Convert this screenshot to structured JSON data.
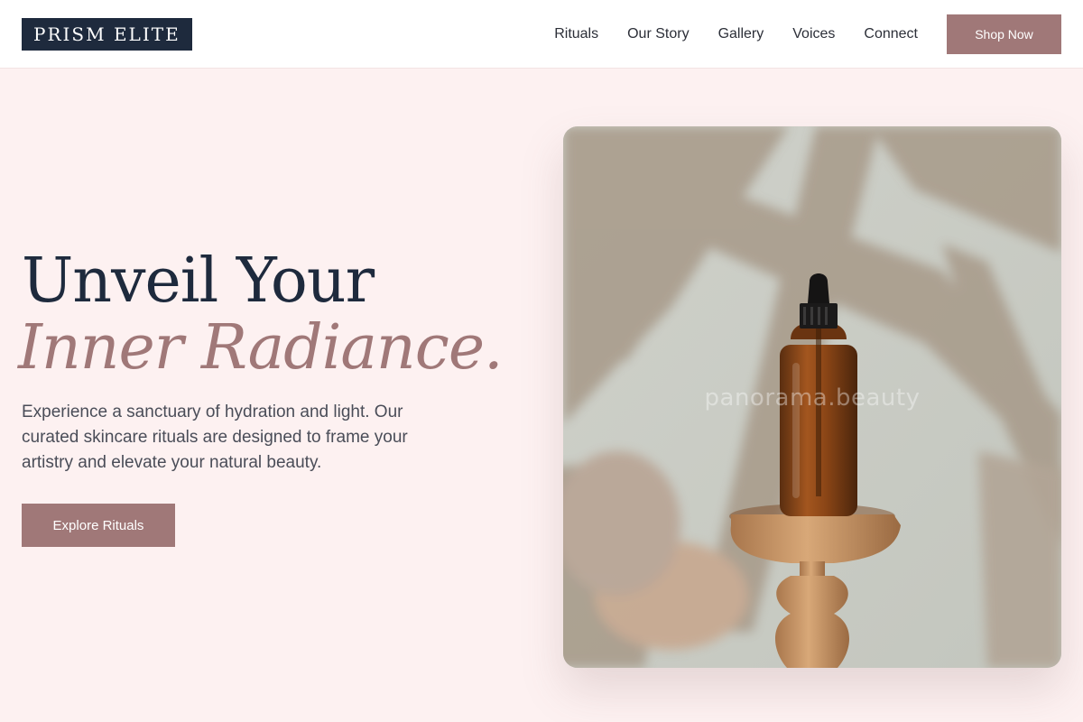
{
  "brand": {
    "name": "PRISM ELITE"
  },
  "nav": {
    "items": [
      {
        "label": "Rituals"
      },
      {
        "label": "Our Story"
      },
      {
        "label": "Gallery"
      },
      {
        "label": "Voices"
      },
      {
        "label": "Connect"
      }
    ],
    "cta_label": "Shop Now"
  },
  "hero": {
    "headline_line1": "Unveil Your",
    "headline_line2": "Inner Radiance.",
    "subcopy": "Experience a sanctuary of hydration and light. Our curated skincare rituals are designed to frame your artistry and elevate your natural beauty.",
    "cta_label": "Explore Rituals",
    "image_watermark": "panorama.beauty"
  },
  "colors": {
    "page_background": "#fdf1f1",
    "navy": "#1e2a3d",
    "accent_rose": "#a07878",
    "body_text": "#4a4d58"
  }
}
